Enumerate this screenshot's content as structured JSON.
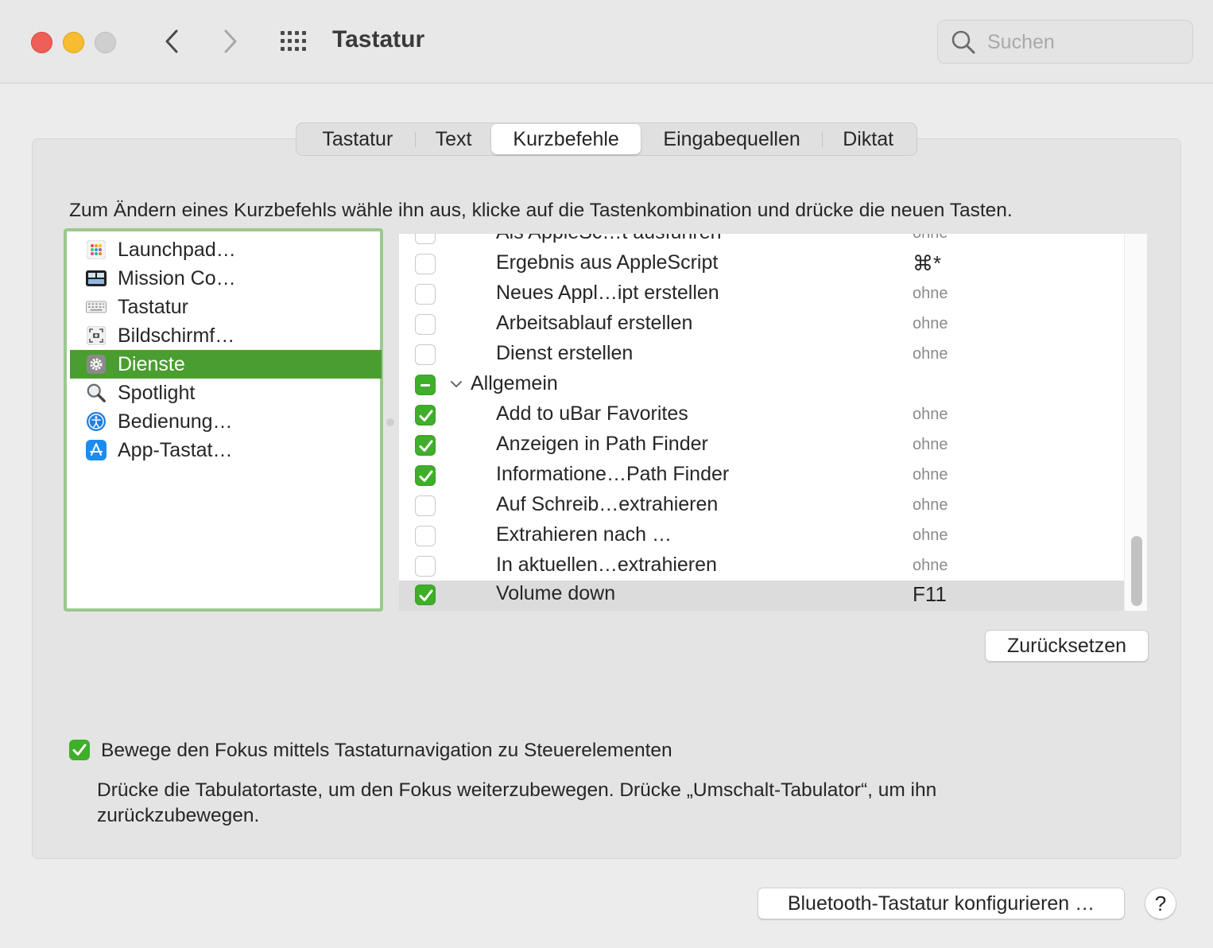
{
  "window": {
    "title": "Tastatur",
    "search_placeholder": "Suchen"
  },
  "tabs": [
    {
      "label": "Tastatur",
      "active": false
    },
    {
      "label": "Text",
      "active": false
    },
    {
      "label": "Kurzbefehle",
      "active": true
    },
    {
      "label": "Eingabequellen",
      "active": false
    },
    {
      "label": "Diktat",
      "active": false
    }
  ],
  "instruction": "Zum Ändern eines Kurzbefehls wähle ihn aus, klicke auf die Tastenkombination und drücke die neuen Tasten.",
  "categories": [
    {
      "label": "Launchpad…",
      "icon": "launchpad-icon",
      "selected": false
    },
    {
      "label": "Mission Co…",
      "icon": "mission-control-icon",
      "selected": false
    },
    {
      "label": "Tastatur",
      "icon": "keyboard-icon",
      "selected": false
    },
    {
      "label": "Bildschirmf…",
      "icon": "screenshot-icon",
      "selected": false
    },
    {
      "label": "Dienste",
      "icon": "gear-icon",
      "selected": true
    },
    {
      "label": "Spotlight",
      "icon": "spotlight-icon",
      "selected": false
    },
    {
      "label": "Bedienung…",
      "icon": "accessibility-icon",
      "selected": false
    },
    {
      "label": "App-Tastat…",
      "icon": "app-store-icon",
      "selected": false
    }
  ],
  "shortcuts": [
    {
      "label": "Als AppleSc…t ausführen",
      "key": "ohne",
      "state": "off"
    },
    {
      "label": "Ergebnis aus AppleScript",
      "key": "⌘*",
      "state": "off"
    },
    {
      "label": "Neues Appl…ipt erstellen",
      "key": "ohne",
      "state": "off"
    },
    {
      "label": "Arbeitsablauf erstellen",
      "key": "ohne",
      "state": "off"
    },
    {
      "label": "Dienst erstellen",
      "key": "ohne",
      "state": "off"
    },
    {
      "label": "Allgemein",
      "key": "",
      "state": "mixed",
      "group": true
    },
    {
      "label": "Add to uBar Favorites",
      "key": "ohne",
      "state": "on"
    },
    {
      "label": "Anzeigen in Path Finder",
      "key": "ohne",
      "state": "on"
    },
    {
      "label": "Informatione…Path Finder",
      "key": "ohne",
      "state": "on"
    },
    {
      "label": "Auf Schreib…extrahieren",
      "key": "ohne",
      "state": "off"
    },
    {
      "label": "Extrahieren nach …",
      "key": "ohne",
      "state": "off"
    },
    {
      "label": "In aktuellen…extrahieren",
      "key": "ohne",
      "state": "off"
    },
    {
      "label": "Volume down",
      "key": "F11",
      "state": "on",
      "selected": true
    }
  ],
  "buttons": {
    "reset": "Zurücksetzen",
    "bluetooth": "Bluetooth-Tastatur konfigurieren …",
    "help": "?"
  },
  "focus_option": {
    "checked": true,
    "label": "Bewege den Fokus mittels Tastaturnavigation zu Steuerelementen",
    "hint": "Drücke die Tabulatortaste, um den Fokus weiterzubewegen. Drücke „Umschalt-Tabulator“, um ihn zurückzubewegen."
  },
  "colors": {
    "accent_green": "#3fae29",
    "selection_green": "#4a9e30",
    "list_focus_ring": "#9bc98e",
    "traffic_close": "#ee5f58",
    "traffic_minimize": "#f7bc2f"
  }
}
